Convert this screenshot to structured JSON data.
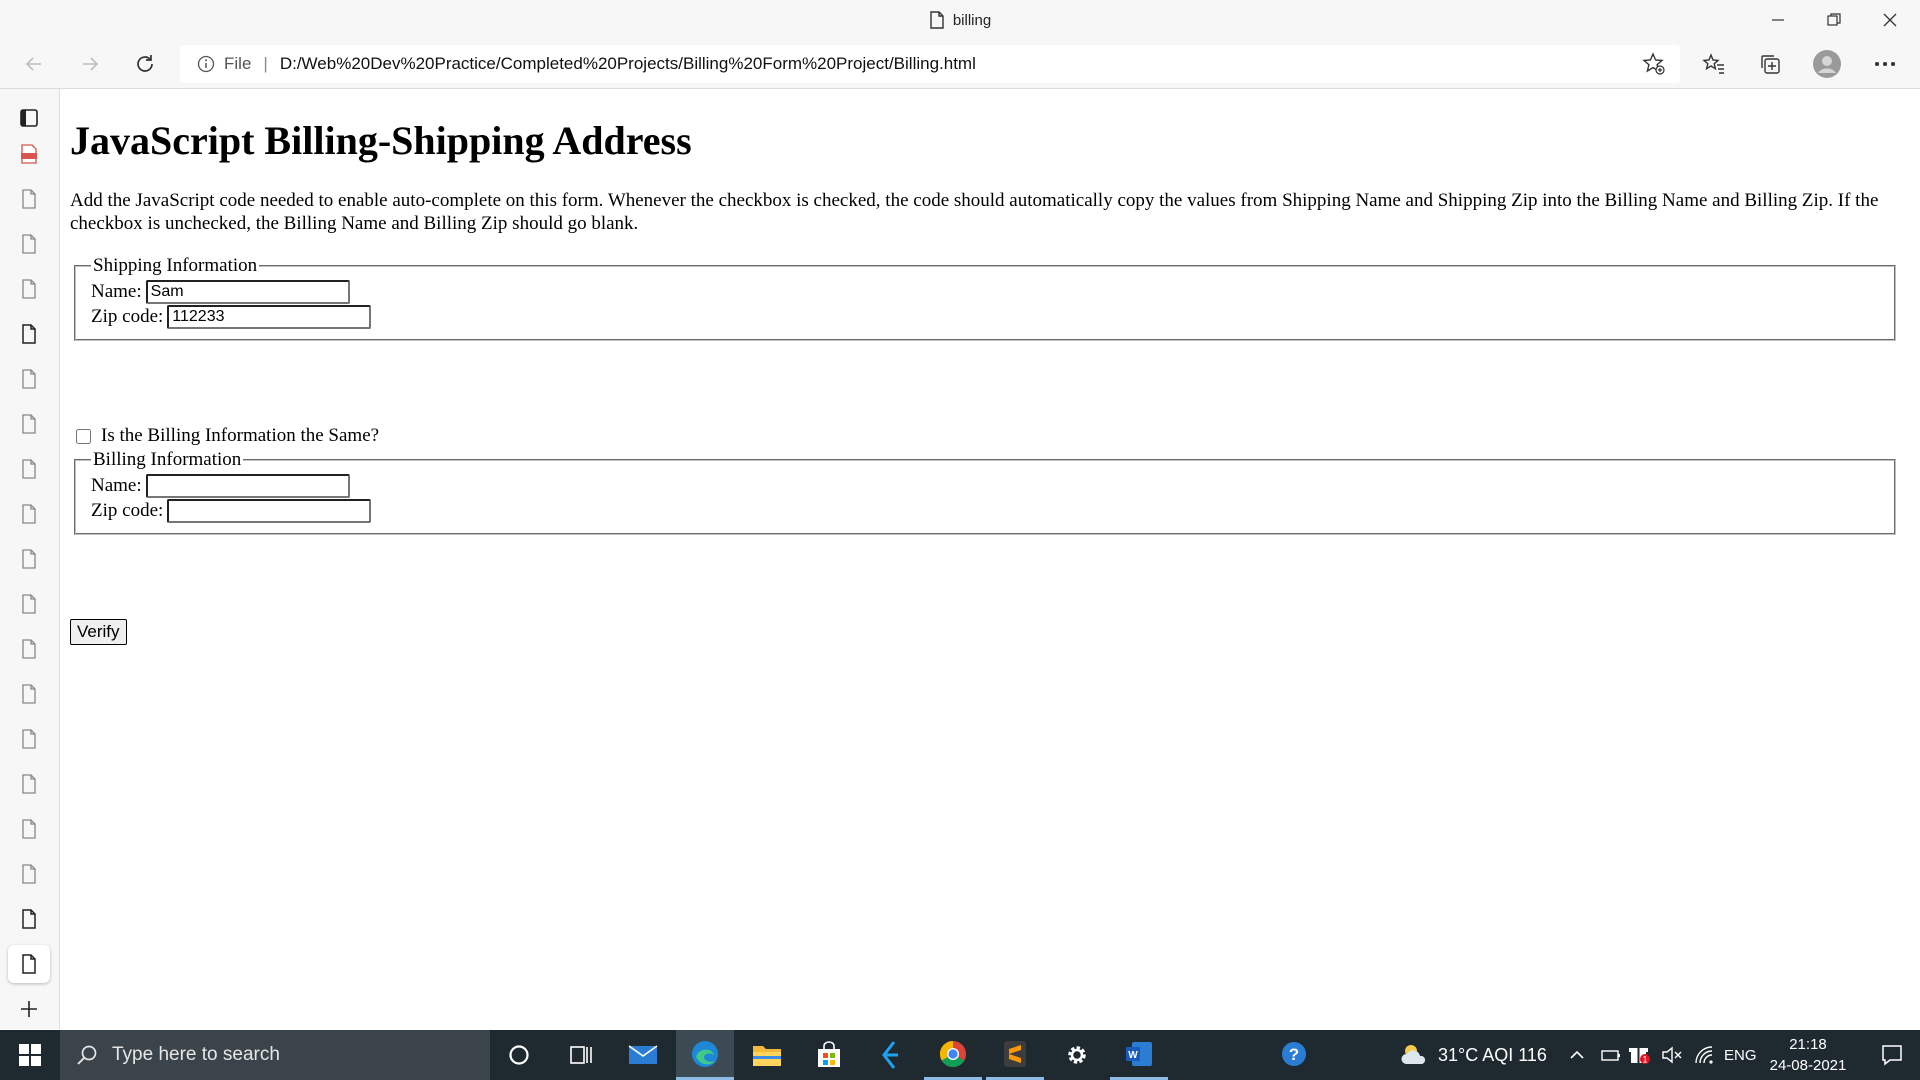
{
  "browser": {
    "tab_title": "billing",
    "address_scheme": "File",
    "address_url": "D:/Web%20Dev%20Practice/Completed%20Projects/Billing%20Form%20Project/Billing.html"
  },
  "page": {
    "title": "JavaScript Billing-Shipping Address",
    "description": "Add the JavaScript code needed to enable auto-complete on this form. Whenever the checkbox is checked, the code should automatically copy the values from Shipping Name and Shipping Zip into the Billing Name and Billing Zip. If the checkbox is unchecked, the Billing Name and Billing Zip should go blank.",
    "shipping": {
      "legend": "Shipping Information",
      "name_label": "Name:",
      "name_value": "Sam",
      "zip_label": "Zip code:",
      "zip_value": "112233"
    },
    "same_checkbox_label": "Is the Billing Information the Same?",
    "same_checkbox_checked": false,
    "billing": {
      "legend": "Billing Information",
      "name_label": "Name:",
      "name_value": "",
      "zip_label": "Zip code:",
      "zip_value": ""
    },
    "verify_label": "Verify"
  },
  "taskbar": {
    "search_placeholder": "Type here to search",
    "weather": "31°C AQI 116",
    "language": "ENG",
    "time": "21:18",
    "date": "24-08-2021"
  },
  "colors": {
    "taskbar": "#1f2a30",
    "search_box": "#3a444a",
    "chrome": "#f7f7f7",
    "pdf_icon": "#d9534f"
  }
}
